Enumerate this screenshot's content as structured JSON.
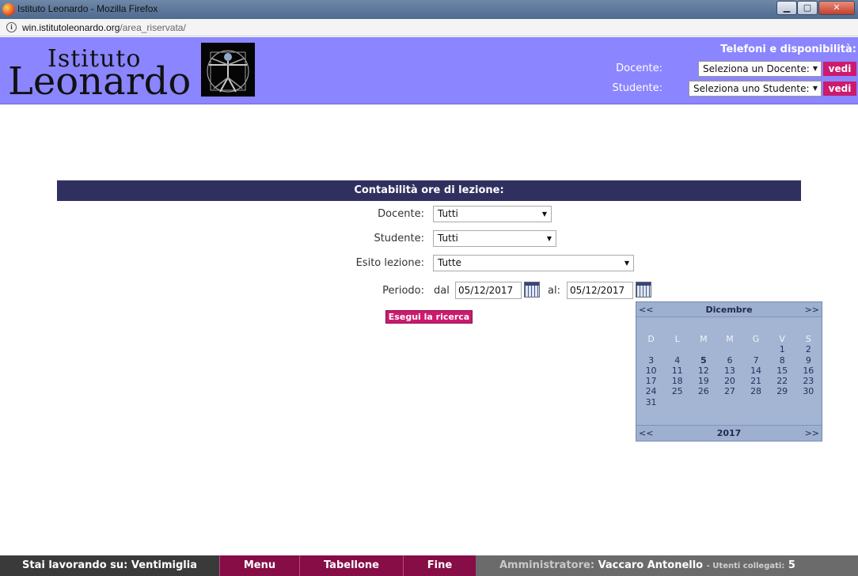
{
  "window": {
    "title": "Istituto Leonardo - Mozilla Firefox",
    "url_domain": "win.istitutoleonardo.org",
    "url_path": "/area_riservata/",
    "buttons": {
      "minimize": "▁",
      "maximize": "▢",
      "close": "✕"
    }
  },
  "header": {
    "logo_word1": "Istituto",
    "logo_word2": "Leonardo",
    "title": "Telefoni e disponibilità:",
    "docente_label": "Docente:",
    "docente_select": "Seleziona un Docente:",
    "studente_label": "Studente:",
    "studente_select": "Seleziona uno Studente:",
    "vedi": "vedi",
    "bg_color": "#8b85ff",
    "button_color": "#cc1a6e"
  },
  "form": {
    "heading": "Contabilità ore di lezione:",
    "docente_label": "Docente:",
    "docente_value": "Tutti",
    "studente_label": "Studente:",
    "studente_value": "Tutti",
    "esito_label": "Esito lezione:",
    "esito_value": "Tutte",
    "periodo_label": "Periodo:",
    "dal_label": "dal",
    "dal_value": "05/12/2017",
    "al_label": "al:",
    "al_value": "05/12/2017",
    "search_button": "Esegui la ricerca",
    "heading_color": "#303060"
  },
  "calendar": {
    "month": "Dicembre",
    "year": "2017",
    "prev": "<<",
    "next": ">>",
    "weekdays": [
      "D",
      "L",
      "M",
      "M",
      "G",
      "V",
      "S"
    ],
    "weeks": [
      [
        "",
        "",
        "",
        "",
        "",
        "1",
        "2"
      ],
      [
        "3",
        "4",
        "5",
        "6",
        "7",
        "8",
        "9"
      ],
      [
        "10",
        "11",
        "12",
        "13",
        "14",
        "15",
        "16"
      ],
      [
        "17",
        "18",
        "19",
        "20",
        "21",
        "22",
        "23"
      ],
      [
        "24",
        "25",
        "26",
        "27",
        "28",
        "29",
        "30"
      ],
      [
        "31",
        "",
        "",
        "",
        "",
        "",
        ""
      ]
    ],
    "selected_day": "5"
  },
  "footer": {
    "working_on": "Stai lavorando su: Ventimiglia",
    "menu": "Menu",
    "tabellone": "Tabellone",
    "fine": "Fine",
    "admin_label": "Amministratore:",
    "admin_name": "Vaccaro Antonello",
    "users_label": "- Utenti collegati:",
    "users_count": "5"
  }
}
